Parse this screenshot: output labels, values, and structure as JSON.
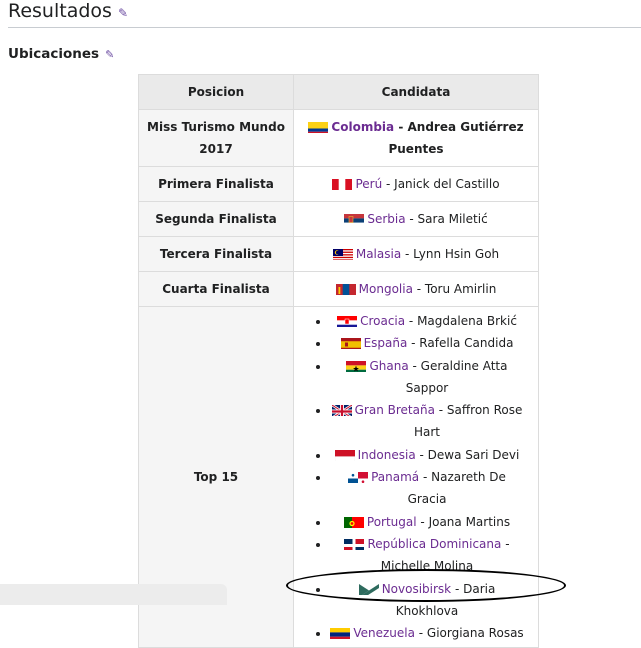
{
  "heading": {
    "title": "Resultados"
  },
  "subheading": {
    "title": "Ubicaciones"
  },
  "table": {
    "headers": {
      "position": "Posicion",
      "candidate": "Candidata"
    },
    "placements": [
      {
        "position": "Miss Turismo Mundo 2017",
        "country": "Colombia",
        "name": "Andrea Gutiérrez Puentes",
        "flag": "colombia"
      },
      {
        "position": "Primera Finalista",
        "country": "Perú",
        "name": "Janick del Castillo",
        "flag": "peru"
      },
      {
        "position": "Segunda Finalista",
        "country": "Serbia",
        "name": "Sara Miletić",
        "flag": "serbia"
      },
      {
        "position": "Tercera Finalista",
        "country": "Malasia",
        "name": "Lynn Hsin Goh",
        "flag": "malaysia"
      },
      {
        "position": "Cuarta Finalista",
        "country": "Mongolia",
        "name": "Toru Amirlin",
        "flag": "mongolia"
      }
    ],
    "top15": {
      "position": "Top 15",
      "entries": [
        {
          "country": "Croacia",
          "name": "Magdalena Brkić",
          "flag": "croatia"
        },
        {
          "country": "España",
          "name": "Rafella Candida",
          "flag": "spain"
        },
        {
          "country": "Ghana",
          "name": "Geraldine Atta Sappor",
          "flag": "ghana"
        },
        {
          "country": "Gran Bretaña",
          "name": "Saffron Rose Hart",
          "flag": "uk"
        },
        {
          "country": "Indonesia",
          "name": "Dewa Sari Devi",
          "flag": "indonesia"
        },
        {
          "country": "Panamá",
          "name": "Nazareth De Gracia",
          "flag": "panama"
        },
        {
          "country": "Portugal",
          "name": "Joana Martins",
          "flag": "portugal"
        },
        {
          "country": "República Dominicana",
          "name": "Michelle Molina",
          "flag": "dominican-republic"
        },
        {
          "country": "Novosibirsk",
          "name": "Daria Khokhlova",
          "flag": "novosibirsk"
        },
        {
          "country": "Venezuela",
          "name": "Giorgiana Rosas",
          "flag": "venezuela"
        }
      ]
    }
  },
  "colors": {
    "link": "#6b2c91",
    "edit_icon": "#6b4ba1",
    "header_bg": "#eaeaea",
    "annotation": "#000000"
  }
}
